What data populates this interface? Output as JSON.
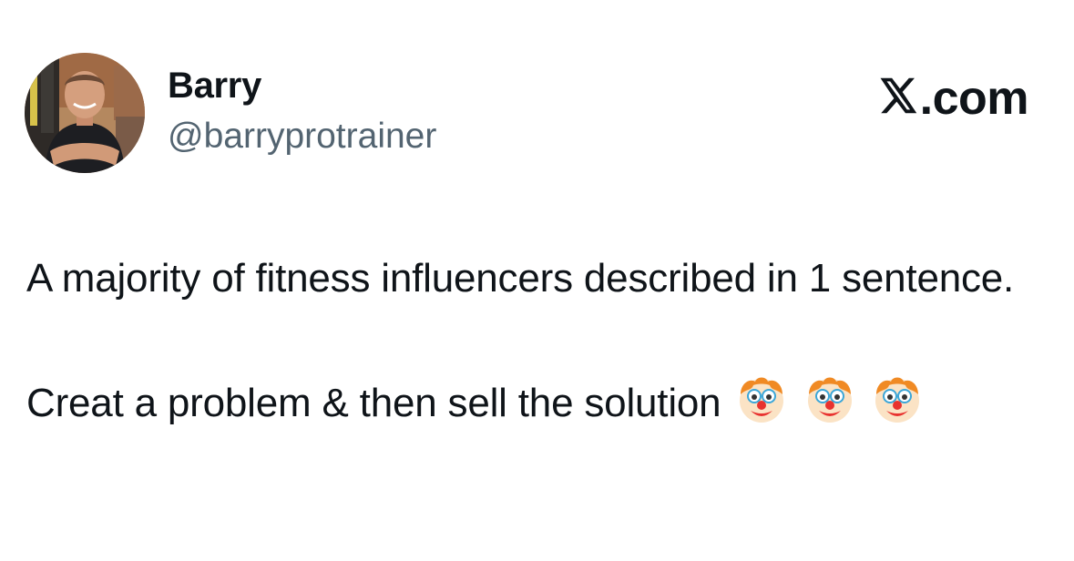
{
  "author": {
    "display_name": "Barry",
    "handle": "@barryprotrainer",
    "avatar_icon": "profile-photo-man-crossed-arms"
  },
  "site": {
    "label": ".com",
    "logo_icon": "x-logo-icon"
  },
  "tweet": {
    "line1": "A majority of fitness influencers described in 1 sentence.",
    "line2": "Creat a problem & then sell the solution",
    "emojis": [
      "clown-face-emoji",
      "clown-face-emoji",
      "clown-face-emoji"
    ]
  },
  "colors": {
    "text": "#0f1419",
    "secondary": "#536471",
    "background": "#ffffff"
  }
}
